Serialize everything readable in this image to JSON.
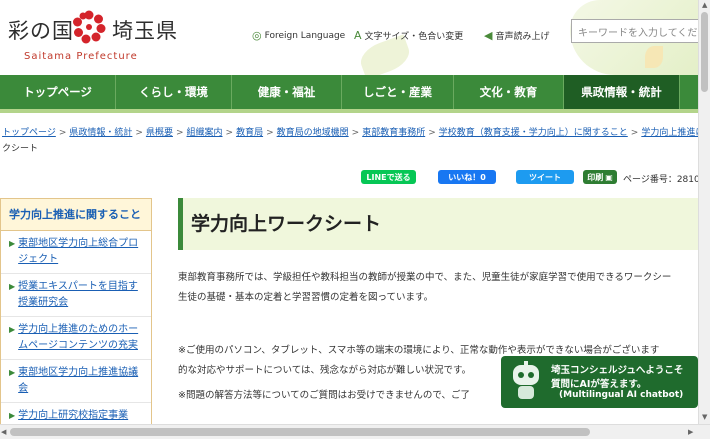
{
  "header": {
    "logo_left": "彩の国",
    "logo_right": "埼玉県",
    "logo_en": "Saitama Prefecture",
    "tools": {
      "foreign": "Foreign Language",
      "font_color": "文字サイズ・色合い変更",
      "read_aloud": "音声読み上げ"
    },
    "search_placeholder": "キーワードを入力してください"
  },
  "nav": {
    "items": [
      "トップページ",
      "くらし・環境",
      "健康・福祉",
      "しごと・産業",
      "文化・教育",
      "県政情報・統計"
    ],
    "active_index": 5,
    "colors": {
      "bar": "#3b8a3a",
      "active": "#1f5e24"
    }
  },
  "breadcrumb": {
    "items": [
      "トップページ",
      "県政情報・統計",
      "県概要",
      "組織案内",
      "教育局",
      "教育局の地域機関",
      "東部教育事務所",
      "学校教育（教育支援・学力向上）に関すること",
      "学力向上推進に"
    ],
    "current": "クシート"
  },
  "share": {
    "line": "LINEで送る",
    "like": "いいね！0",
    "tweet": "ツイート",
    "print": "印刷",
    "page_no": "ページ番号：2810"
  },
  "sidebar": {
    "heading": "学力向上推進に関すること",
    "items": [
      "東部地区学力向上総合プロジェクト",
      "授業エキスパートを目指す授業研究会",
      "学力向上推進のためのホームページコンテンツの充実",
      "東部地区学力向上推進協議会",
      "学力向上研究校指定事業"
    ]
  },
  "main": {
    "title": "学力向上ワークシート",
    "p1": "東部教育事務所では、学級担任や教科担当の教師が授業の中で、また、児童生徒が家庭学習で使用できるワークシー",
    "p1b": "生徒の基礎・基本の定着と学習習慣の定着を図っています。",
    "p2": "※ご使用のパソコン、タブレット、スマホ等の端末の環境により、正常な動作や表示ができない場合がございます",
    "p2b": "的な対応やサポートについては、残念ながら対応が難しい状況です。",
    "p3": "※問題の解答方法等についてのご質問はお受けできませんので、ご了"
  },
  "chatbot": {
    "line1": "埼玉コンシェルジュへようこそ",
    "line2": "質問にAIが答えます。",
    "line3": "(Multilingual AI chatbot)"
  }
}
